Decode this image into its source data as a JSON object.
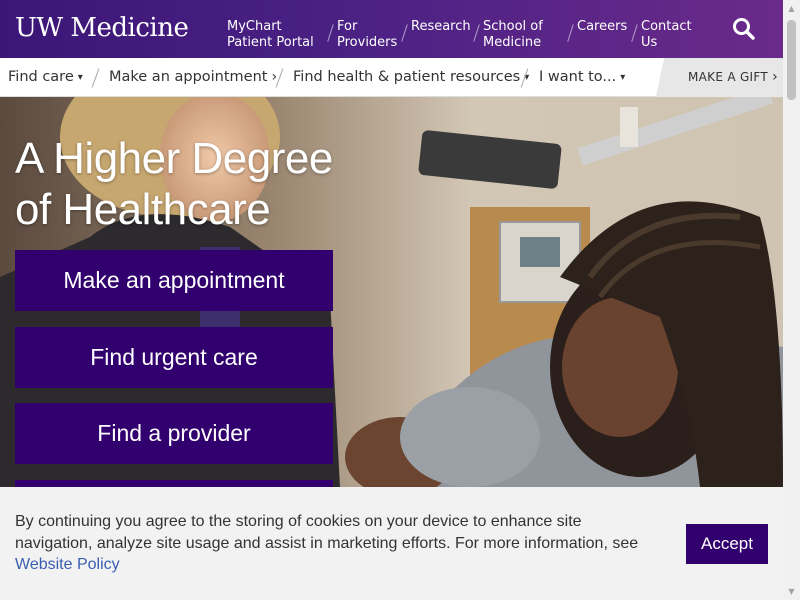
{
  "header": {
    "logo": "UW Medicine",
    "nav": [
      {
        "line1": "MyChart",
        "line2": "Patient Portal"
      },
      {
        "line1": "For",
        "line2": "Providers"
      },
      {
        "line1": "Research",
        "line2": ""
      },
      {
        "line1": "School of",
        "line2": "Medicine"
      },
      {
        "line1": "Careers",
        "line2": ""
      },
      {
        "line1": "Contact",
        "line2": "Us"
      }
    ],
    "search_icon": "search-icon"
  },
  "subnav": {
    "items": [
      {
        "label": "Find care",
        "chevron": "▾"
      },
      {
        "label": "Make an appointment",
        "chevron": "›"
      },
      {
        "label": "Find health & patient resources",
        "chevron": "▾"
      },
      {
        "label": "I want to...",
        "chevron": "▾"
      }
    ],
    "gift": "MAKE A GIFT",
    "gift_chevron": "›"
  },
  "hero": {
    "title_line1": "A Higher Degree",
    "title_line2": "of Healthcare",
    "ctas": [
      "Make an appointment",
      "Find urgent care",
      "Find a provider"
    ]
  },
  "cookie": {
    "text": "By continuing you agree to the storing of cookies on your device to enhance site navigation, analyze site usage and assist in marketing efforts. For more information, see ",
    "link": "Website Policy",
    "accept": "Accept"
  },
  "colors": {
    "brand_purple": "#32006e",
    "header_gradient_start": "#3b1677",
    "header_gradient_end": "#6a2a8a",
    "link_blue": "#3a5eb0"
  }
}
